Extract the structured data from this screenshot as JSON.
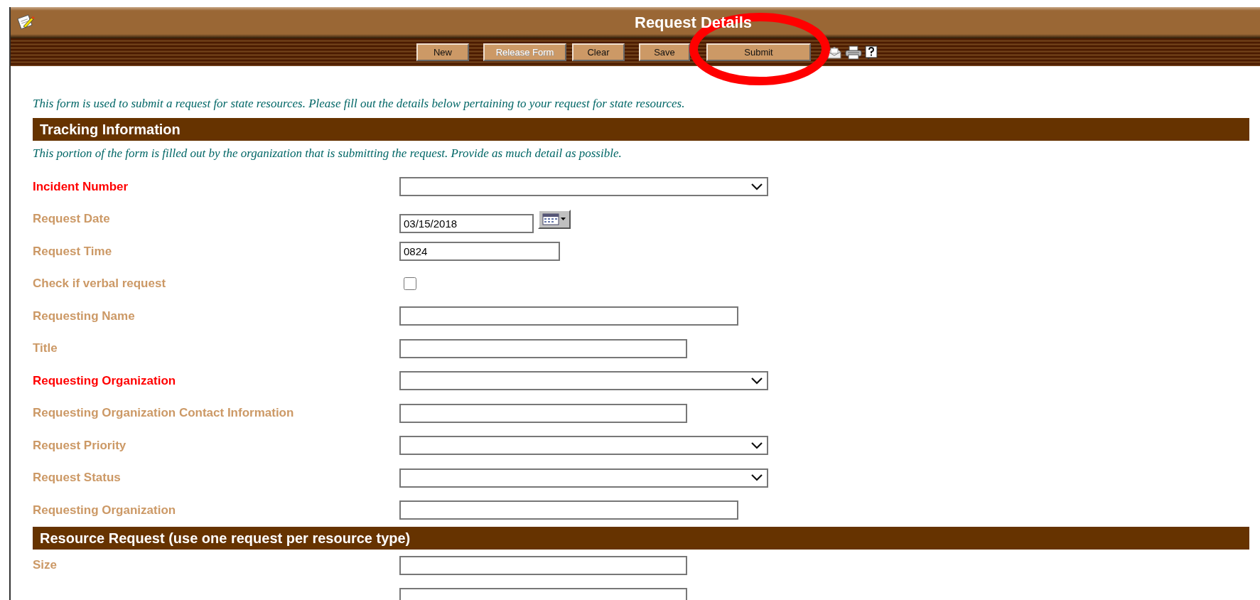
{
  "window": {
    "title": "Request Details"
  },
  "toolbar": {
    "buttons": [
      {
        "label": "New",
        "disabled": false
      },
      {
        "label": "Release Form",
        "disabled": true
      },
      {
        "label": "Clear",
        "disabled": false
      },
      {
        "label": "Save",
        "disabled": false
      },
      {
        "label": "Submit",
        "disabled": false
      }
    ],
    "icons": [
      {
        "kind": "envelope"
      },
      {
        "kind": "printer"
      },
      {
        "kind": "help"
      }
    ]
  },
  "annotations": [
    {
      "kind": "ellipse"
    }
  ],
  "intro": "This form is used to submit a request for state resources. Please fill out the details below pertaining to your request for state resources.",
  "sections": [
    {
      "title": "Tracking Information",
      "note": "This portion of the form is filled out by the organization that is submitting the request. Provide as much detail as possible.",
      "fields": [
        {
          "label": "Incident Number",
          "required": true,
          "kind": "select"
        },
        {
          "label": "Request Date",
          "required": false,
          "kind": "date",
          "value": "03/15/2018"
        },
        {
          "label": "Request Time",
          "required": false,
          "kind": "text",
          "value": "0824"
        },
        {
          "label": "Check if verbal request",
          "required": false,
          "kind": "checkbox",
          "checked": false
        },
        {
          "label": "Requesting Name",
          "required": false,
          "kind": "text"
        },
        {
          "label": "Title",
          "required": false,
          "kind": "text"
        },
        {
          "label": "Requesting Organization",
          "required": true,
          "kind": "select"
        },
        {
          "label": "Requesting Organization Contact Information",
          "required": false,
          "kind": "text"
        },
        {
          "label": "Request Priority",
          "required": false,
          "kind": "select"
        },
        {
          "label": "Request Status",
          "required": false,
          "kind": "select"
        },
        {
          "label": "Requesting Organization",
          "required": false,
          "kind": "text"
        }
      ]
    },
    {
      "title": "Resource Request (use one request per resource type)",
      "fields": [
        {
          "label": "Size",
          "required": false,
          "kind": "text"
        },
        {
          "kind": "text"
        }
      ]
    }
  ]
}
